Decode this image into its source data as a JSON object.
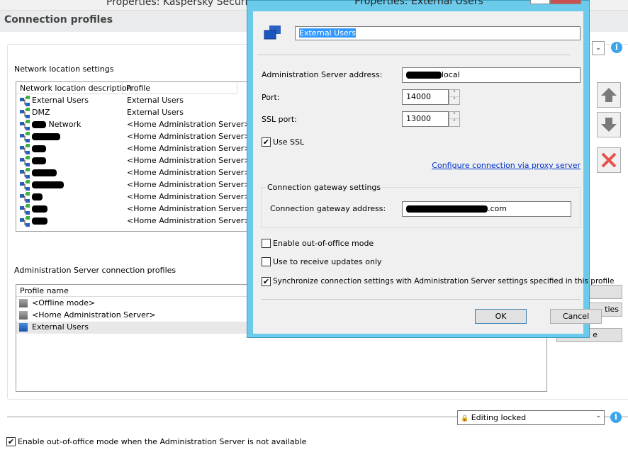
{
  "window": {
    "title": "Properties: Kaspersky Security",
    "section": "Connection profiles"
  },
  "network": {
    "label": "Network location settings",
    "columns": [
      "Network location description",
      "Profile"
    ],
    "rows": [
      {
        "desc": "External Users",
        "profile": "External Users"
      },
      {
        "desc": "DMZ",
        "profile": "External Users"
      },
      {
        "desc": "Network",
        "profile": "<Home Administration Server>",
        "redacted": true
      },
      {
        "desc": "",
        "profile": "<Home Administration Server>",
        "redacted": true
      },
      {
        "desc": "",
        "profile": "<Home Administration Server>",
        "redacted": true
      },
      {
        "desc": "",
        "profile": "<Home Administration Server>",
        "redacted": true
      },
      {
        "desc": "",
        "profile": "<Home Administration Server>",
        "redacted": true
      },
      {
        "desc": "",
        "profile": "<Home Administration Server>",
        "redacted": true
      },
      {
        "desc": "",
        "profile": "<Home Administration Server>",
        "redacted": true
      },
      {
        "desc": "",
        "profile": "<Home Administration Server>",
        "redacted": true
      },
      {
        "desc": "",
        "profile": "<Home Administration Server>",
        "redacted": true
      }
    ]
  },
  "admin_profiles": {
    "label": "Administration Server connection profiles",
    "column": "Profile name",
    "rows": [
      "<Offline mode>",
      "<Home Administration Server>",
      "External Users"
    ],
    "button_fragments": [
      "ties",
      "e"
    ]
  },
  "footer": {
    "lock_select": "Editing locked",
    "checkbox": "Enable out-of-office mode when the Administration Server is not available",
    "checked": true
  },
  "dialog": {
    "title": "Properties: External Users",
    "name": "External Users",
    "address_label": "Administration Server address:",
    "address_value": "local",
    "port_label": "Port:",
    "port_value": "14000",
    "ssl_port_label": "SSL port:",
    "ssl_port_value": "13000",
    "use_ssl": "Use SSL",
    "use_ssl_checked": true,
    "proxy_link": "Configure connection via proxy server",
    "gateway_group": "Connection gateway settings",
    "gateway_label": "Connection gateway address:",
    "gateway_value": ".com",
    "out_of_office": "Enable out-of-office mode",
    "out_of_office_checked": false,
    "updates_only": "Use to receive updates only",
    "updates_only_checked": false,
    "sync": "Synchronize connection settings with Administration Server settings specified in this profile",
    "sync_checked": true,
    "ok": "OK",
    "cancel": "Cancel"
  },
  "colors": {
    "dialog_border": "#6ccbea",
    "link": "#0033cc",
    "delete": "#e8514a"
  }
}
